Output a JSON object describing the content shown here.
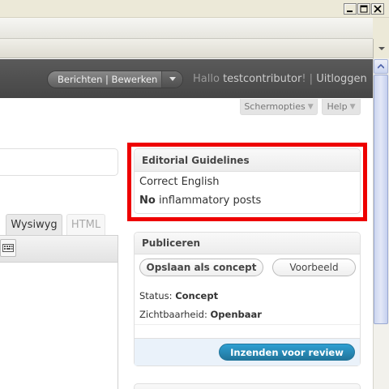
{
  "window": {
    "minimize_icon": "minimize-icon",
    "maximize_icon": "maximize-icon",
    "close_icon": "close-icon"
  },
  "adminbar": {
    "favorites_label": "Berichten | Bewerken",
    "greeting_prefix": "Hallo ",
    "username": "testcontributor",
    "greeting_suffix": "!",
    "separator": " | ",
    "logout_label": "Uitloggen",
    "background": "#464646"
  },
  "screen_meta": {
    "screen_options_label": "Schermopties",
    "help_label": "Help"
  },
  "editor": {
    "tab_visual": "Wysiwyg",
    "tab_html": "HTML"
  },
  "guidelines": {
    "title": "Editorial Guidelines",
    "line1": "Correct English",
    "line2_bold": "No",
    "line2_rest": " inflammatory posts",
    "highlight_color": "#ee0000"
  },
  "publish": {
    "title": "Publiceren",
    "save_draft_label": "Opslaan als concept",
    "preview_label": "Voorbeeld",
    "status_label": "Status: ",
    "status_value": "Concept",
    "visibility_label": "Zichtbaarheid: ",
    "visibility_value": "Openbaar",
    "submit_label": "Inzenden voor review",
    "submit_color": "#21759b"
  }
}
